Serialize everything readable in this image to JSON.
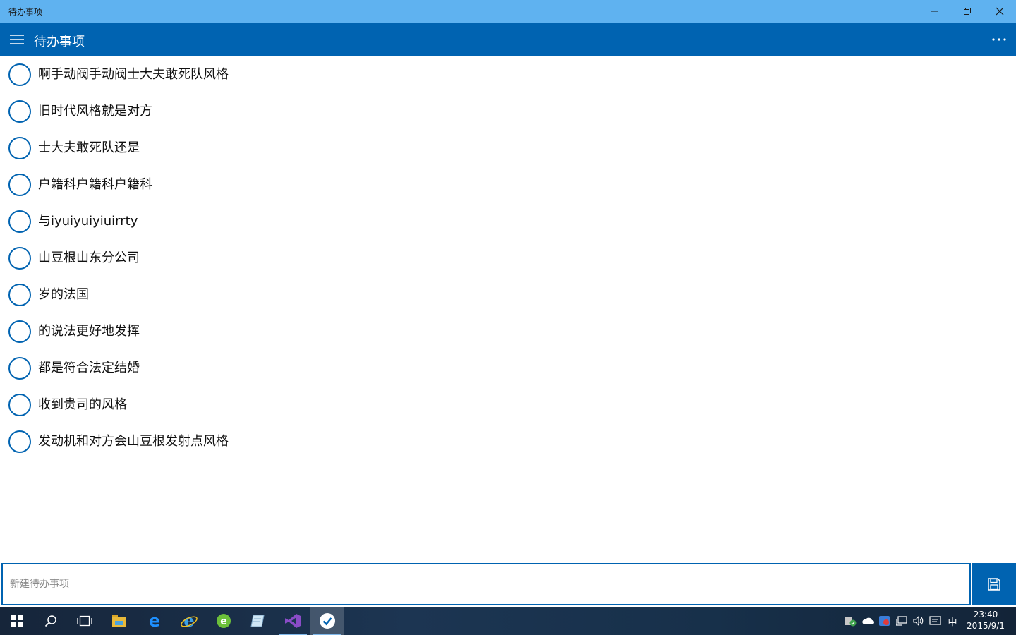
{
  "window": {
    "title": "待办事项"
  },
  "appbar": {
    "title": "待办事项"
  },
  "todos": [
    {
      "text": "啊手动阀手动阀士大夫敢死队风格"
    },
    {
      "text": "旧时代风格就是对方"
    },
    {
      "text": "士大夫敢死队还是"
    },
    {
      "text": "户籍科户籍科户籍科"
    },
    {
      "text": "与iyuiyuiyiuirrty"
    },
    {
      "text": "山豆根山东分公司"
    },
    {
      "text": "岁的法国"
    },
    {
      "text": "的说法更好地发挥"
    },
    {
      "text": "都是符合法定结婚"
    },
    {
      "text": "收到贵司的风格"
    },
    {
      "text": "发动机和对方会山豆根发射点风格"
    }
  ],
  "new_item": {
    "placeholder": "新建待办事项",
    "value": ""
  },
  "colors": {
    "accent": "#0063b1",
    "titlebar": "#5fb2f0"
  },
  "taskbar": {
    "apps": [
      "start-icon",
      "search-icon",
      "task-view-icon",
      "file-explorer-icon",
      "edge-icon",
      "internet-explorer-icon",
      "green-browser-icon",
      "notepad-icon",
      "visual-studio-icon",
      "todo-app-icon"
    ],
    "ime": "中",
    "time": "23:40",
    "date": "2015/9/1"
  }
}
